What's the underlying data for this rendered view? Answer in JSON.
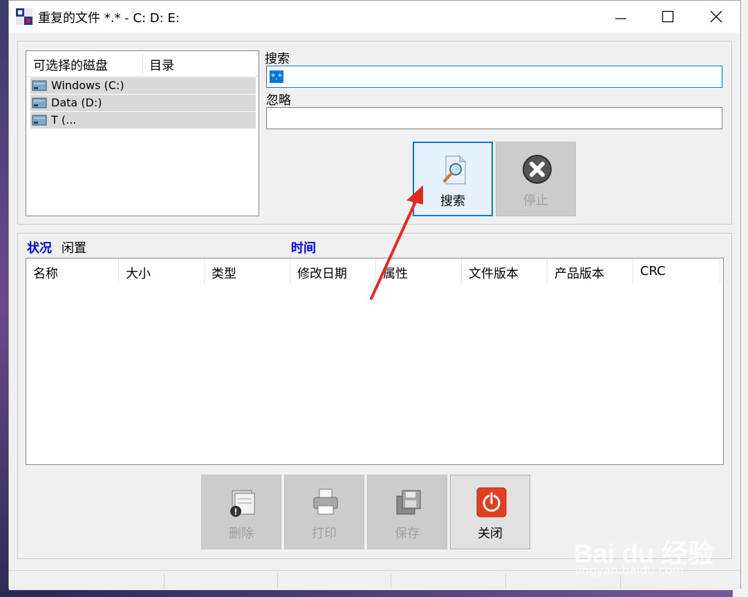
{
  "window": {
    "title": "重复的文件 *.* - C: D: E:"
  },
  "drives": {
    "col_disk": "可选择的磁盘",
    "col_dir": "目录",
    "items": [
      {
        "label": "Windows (C:)",
        "selected": true
      },
      {
        "label": "Data (D:)",
        "selected": true
      },
      {
        "label": "T          (...",
        "selected": true
      }
    ]
  },
  "search": {
    "label": "搜索",
    "value": "*.*"
  },
  "ignore": {
    "label": "忽略",
    "value": ""
  },
  "buttons": {
    "search": "搜索",
    "stop": "停止",
    "delete": "删除",
    "print": "打印",
    "save": "保存",
    "close": "关闭"
  },
  "status": {
    "label": "状况",
    "value": "闲置",
    "time_label": "时间"
  },
  "results": {
    "columns": [
      "名称",
      "大小",
      "类型",
      "修改日期",
      "属性",
      "文件版本",
      "产品版本",
      "CRC"
    ]
  },
  "watermark": {
    "logo": "Bai du 经验",
    "url": "jingyan.baidu.com"
  },
  "colors": {
    "accent": "#0078d7",
    "status_blue": "#0000ff",
    "arrow_red": "#e8281e"
  }
}
